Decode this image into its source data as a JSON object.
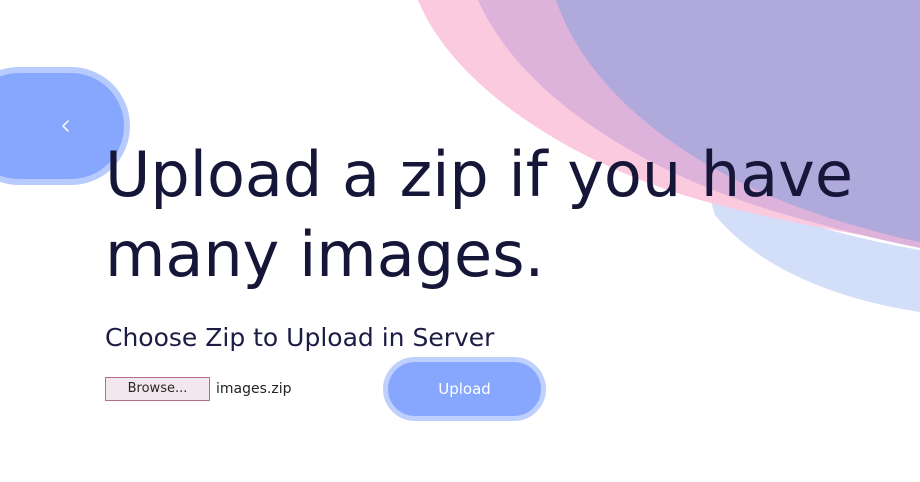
{
  "colors": {
    "accent": "#87a7ff",
    "accent_ring": "#b8cbfd",
    "blob_pink": "#fccadf",
    "blob_mauve": "#ddb3db",
    "blob_lavender": "#b0a9db",
    "heading_text": "#161638"
  },
  "nav": {
    "back_icon": "chevron-left-icon"
  },
  "main": {
    "headline_line1": "Upload a zip if you have",
    "headline_line2": "many images.",
    "subheading": "Choose Zip to Upload in Server"
  },
  "upload_form": {
    "browse_label": "Browse...",
    "file_name": "images.zip",
    "upload_label": "Upload"
  }
}
